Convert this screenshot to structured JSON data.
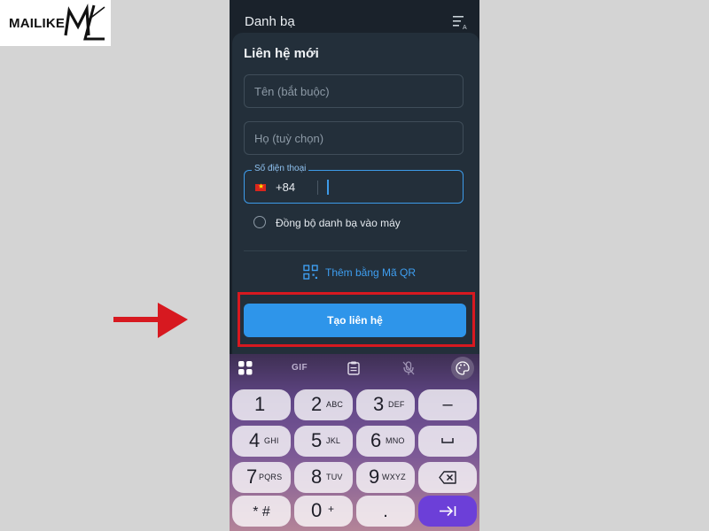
{
  "logo": {
    "text": "MAILIKE",
    "mark_text": "ML"
  },
  "phone": {
    "header": {
      "title": "Danh bạ",
      "sort_icon": "sort-az-icon"
    },
    "sheet": {
      "title": "Liên hệ mới",
      "first_name": {
        "placeholder": "Tên (bắt buộc)",
        "value": ""
      },
      "last_name": {
        "placeholder": "Họ (tuỳ chọn)",
        "value": ""
      },
      "phone_field": {
        "label": "Số điện thoại",
        "country_code": "+84",
        "value": "",
        "flag": "vietnam-flag-icon"
      },
      "sync_option": {
        "label": "Đồng bộ danh bạ vào máy",
        "checked": false
      },
      "qr_link": {
        "label": "Thêm bằng Mã QR",
        "icon": "qr-code-icon"
      },
      "create_button": {
        "label": "Tạo liên hệ"
      }
    },
    "keyboard": {
      "tools": [
        {
          "name": "apps-grid-icon"
        },
        {
          "name": "gif-button",
          "label": "GIF"
        },
        {
          "name": "clipboard-icon"
        },
        {
          "name": "mic-off-icon"
        },
        {
          "name": "palette-icon"
        }
      ],
      "keys": {
        "k1": {
          "num": "1",
          "letters": ""
        },
        "k2": {
          "num": "2",
          "letters": "ABC"
        },
        "k3": {
          "num": "3",
          "letters": "DEF"
        },
        "k4": {
          "num": "4",
          "letters": "GHI"
        },
        "k5": {
          "num": "5",
          "letters": "JKL"
        },
        "k6": {
          "num": "6",
          "letters": "MNO"
        },
        "k7": {
          "num": "7",
          "letters": "PQRS"
        },
        "k8": {
          "num": "8",
          "letters": "TUV"
        },
        "k9": {
          "num": "9",
          "letters": "WXYZ"
        },
        "k0": {
          "num": "0",
          "letters": "+"
        },
        "star": "* #",
        "minus": "–",
        "dot": ".",
        "space_icon": "space-icon",
        "backspace_icon": "backspace-icon",
        "go_icon": "next-field-icon"
      }
    }
  },
  "colors": {
    "accent": "#2e95ea",
    "highlight": "#d71920",
    "arrow": "#d71920",
    "sheet_bg": "#232f3a",
    "keyboard_go": "#6c3fd8"
  }
}
